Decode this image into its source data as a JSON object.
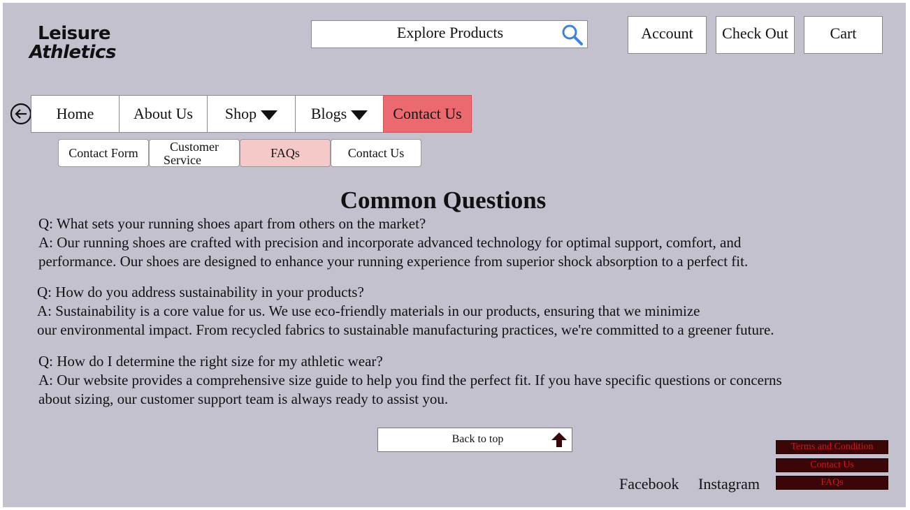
{
  "brand": {
    "line1": "Leisure",
    "line2": "Athletics"
  },
  "search": {
    "label": "Explore Products",
    "icon": "search-icon"
  },
  "header_buttons": {
    "account": "Account",
    "checkout": "Check Out",
    "cart": "Cart"
  },
  "nav": {
    "back_icon": "back-arrow-icon",
    "items": [
      {
        "label": "Home"
      },
      {
        "label": "About Us"
      },
      {
        "label": "Shop",
        "dropdown": true
      },
      {
        "label": "Blogs",
        "dropdown": true
      },
      {
        "label": "Contact Us",
        "active": true
      }
    ]
  },
  "subnav": {
    "items": [
      {
        "label": "Contact Form"
      },
      {
        "line1": "Customer",
        "line2": "Service"
      },
      {
        "label": "FAQs",
        "active": true
      },
      {
        "label": "Contact Us"
      }
    ]
  },
  "main": {
    "heading": "Common Questions",
    "faqs": [
      {
        "question": "Q: What sets your running shoes apart from others on the market?",
        "answer_lines": [
          "A: Our running shoes are crafted with precision and incorporate advanced technology for optimal support, comfort, and",
          "performance. Our shoes are designed to enhance your running experience from superior shock absorption to a perfect fit."
        ]
      },
      {
        "question": "Q: How do you address sustainability in your products?",
        "answer_lines": [
          "A: Sustainability is a core value for us. We use eco-friendly materials in our products, ensuring that we minimize",
          "our environmental impact. From recycled fabrics to sustainable  manufacturing practices, we're committed to a greener future."
        ]
      },
      {
        "question": "Q: How do I determine the right size for my athletic wear?",
        "answer_lines": [
          "A: Our website provides a comprehensive size guide to help you find the perfect fit. If you have specific questions or concerns",
          "about sizing, our customer support team is always ready to assist you."
        ]
      }
    ]
  },
  "back_to_top": {
    "label": "Back to top",
    "icon": "up-arrow-icon"
  },
  "footer": {
    "social": [
      "Facebook",
      "Instagram"
    ],
    "links": [
      "Terms and Condition",
      "Contact Us",
      "FAQs"
    ]
  },
  "colors": {
    "page_background": "#c3c1ce",
    "nav_active": "#ea6a6f",
    "subnav_active": "#f6c9c9",
    "footer_link_bg": "#3a0608",
    "footer_link_text": "#d0181e",
    "search_icon": "#3a82e0"
  }
}
